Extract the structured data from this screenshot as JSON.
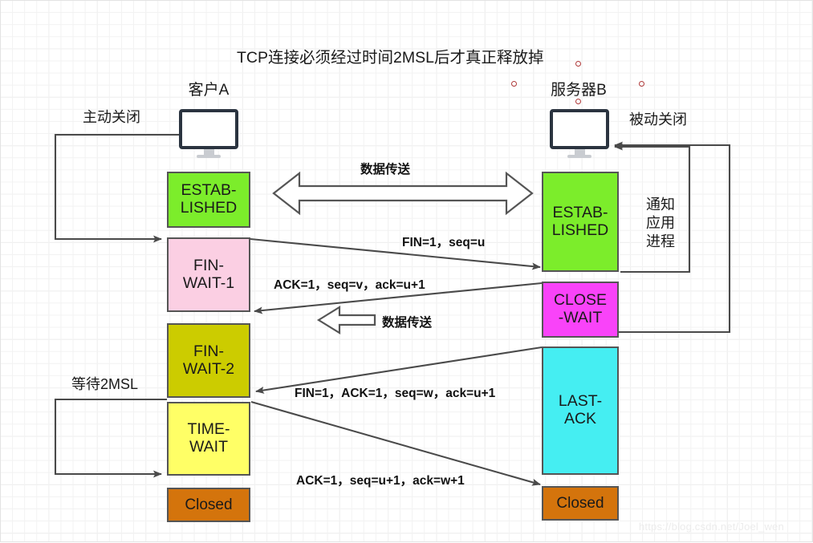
{
  "diagram": {
    "title": "TCP连接必须经过时间2MSL后才真正释放掉",
    "watermark": "https://blog.csdn.net/Joel_wen"
  },
  "actors": {
    "client": {
      "label": "客户A",
      "icon": "monitor-icon"
    },
    "server": {
      "label": "服务器B",
      "icon": "monitor-icon"
    }
  },
  "client_states": [
    {
      "name": "ESTABLISHED",
      "text": "ESTAB-\nLISHED",
      "color": "#7ced2b"
    },
    {
      "name": "FIN-WAIT-1",
      "text": "FIN-\nWAIT-1",
      "color": "#fbcfe3"
    },
    {
      "name": "FIN-WAIT-2",
      "text": "FIN-\nWAIT-2",
      "color": "#cccc00"
    },
    {
      "name": "TIME-WAIT",
      "text": "TIME-\nWAIT",
      "color": "#ffff66"
    },
    {
      "name": "Closed",
      "text": "Closed",
      "color": "#d4740c"
    }
  ],
  "server_states": [
    {
      "name": "ESTABLISHED",
      "text": "ESTAB-\nLISHED",
      "color": "#7ced2b"
    },
    {
      "name": "CLOSE-WAIT",
      "text": "CLOSE\n-WAIT",
      "color": "#f champion"
    },
    {
      "name": "LAST-ACK",
      "text": "LAST-\nACK",
      "color": "#45eef2"
    },
    {
      "name": "Closed",
      "text": "Closed",
      "color": "#d4740c"
    }
  ],
  "annotations": {
    "active_close": "主动关闭",
    "passive_close": "被动关闭",
    "notify_app": "通知\n应用\n进程",
    "wait_2msl": "等待2MSL",
    "data_transfer_top": "数据传送",
    "data_transfer_mid": "数据传送"
  },
  "messages": [
    {
      "id": "fin1",
      "text": "FIN=1，seq=u"
    },
    {
      "id": "ack1",
      "text": "ACK=1，seq=v，ack=u+1"
    },
    {
      "id": "fin2",
      "text": "FIN=1，ACK=1，seq=w，ack=u+1"
    },
    {
      "id": "ack2",
      "text": "ACK=1，seq=u+1，ack=w+1"
    }
  ],
  "colors": {
    "established": "#7ced2b",
    "fin_wait_1": "#fbcfe3",
    "fin_wait_2": "#cccc00",
    "time_wait": "#ffff66",
    "closed": "#d4740c",
    "close_wait": "#f943f9",
    "last_ack": "#45eef2",
    "line": "#555555",
    "handle": "#b03a3a"
  }
}
